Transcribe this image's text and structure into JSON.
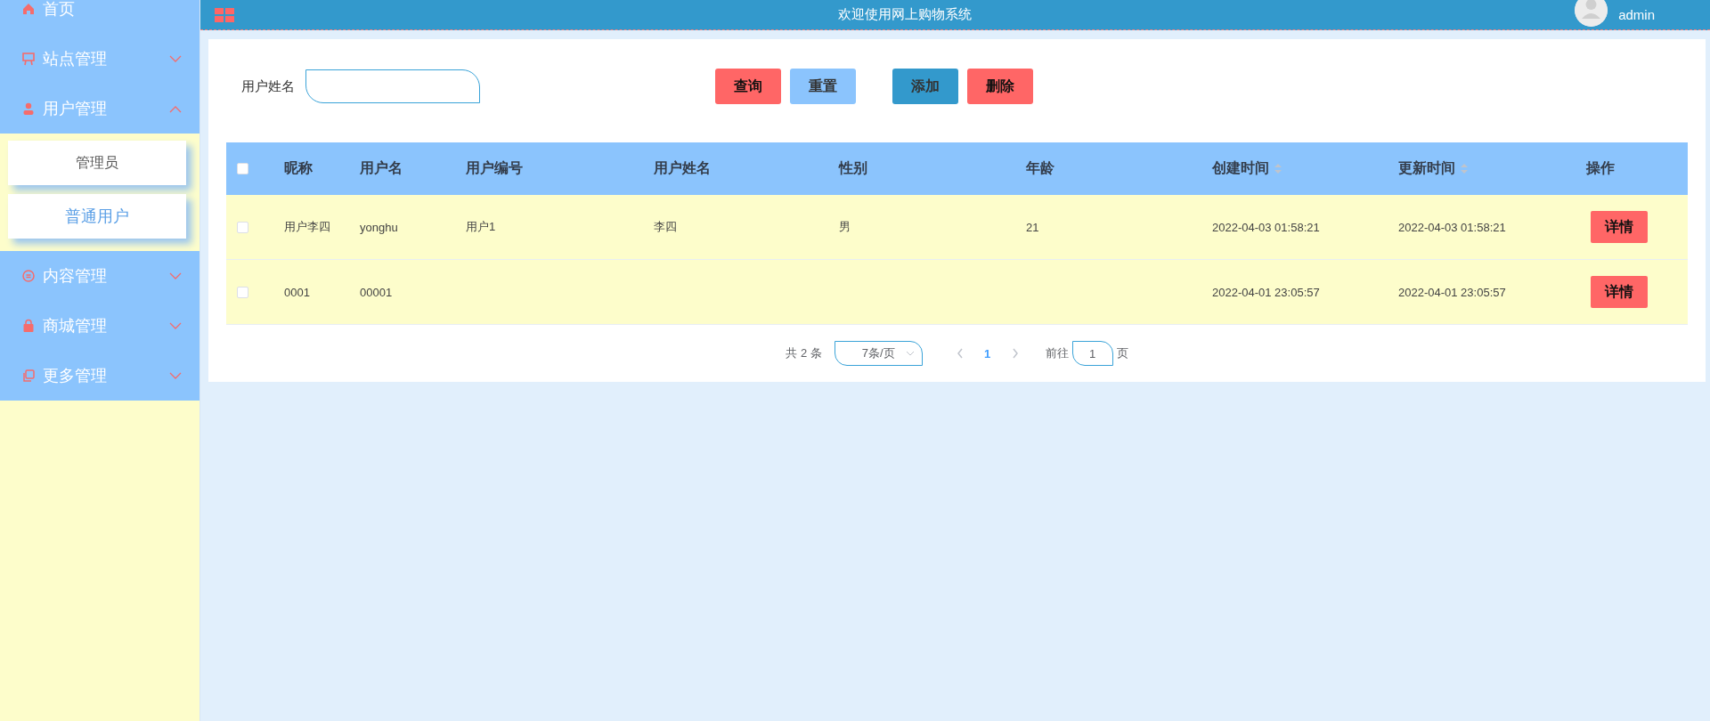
{
  "top_bar": {
    "title": "欢迎使用网上购物系统",
    "user": "admin"
  },
  "sidebar": {
    "items": [
      {
        "label": "首页",
        "kind": "link"
      },
      {
        "label": "站点管理",
        "kind": "submenu",
        "expanded": false
      },
      {
        "label": "用户管理",
        "kind": "submenu",
        "expanded": true,
        "children": [
          {
            "label": "管理员",
            "selected": false
          },
          {
            "label": "普通用户",
            "selected": true
          }
        ]
      },
      {
        "label": "内容管理",
        "kind": "submenu",
        "expanded": false
      },
      {
        "label": "商城管理",
        "kind": "submenu",
        "expanded": false
      },
      {
        "label": "更多管理",
        "kind": "submenu",
        "expanded": false
      }
    ]
  },
  "search": {
    "label": "用户姓名"
  },
  "buttons": [
    {
      "label": "查询",
      "kind": "danger"
    },
    {
      "label": "重置",
      "kind": "light"
    },
    {
      "label": "添加",
      "kind": "primary"
    },
    {
      "label": "删除",
      "kind": "danger"
    }
  ],
  "table": {
    "header_checked": false,
    "columns": [
      {
        "label": "昵称",
        "sortable": false
      },
      {
        "label": "用户名",
        "sortable": false
      },
      {
        "label": "用户编号",
        "sortable": false
      },
      {
        "label": "用户姓名",
        "sortable": false
      },
      {
        "label": "性别",
        "sortable": false
      },
      {
        "label": "年龄",
        "sortable": false
      },
      {
        "label": "创建时间",
        "sortable": true
      },
      {
        "label": "更新时间",
        "sortable": true
      },
      {
        "label": "操作",
        "sortable": false
      }
    ],
    "rows": [
      {
        "checked": false,
        "cells": [
          "用户李四",
          "yonghu",
          "用户1",
          "李四",
          "男",
          "21",
          "2022-04-03 01:58:21",
          "2022-04-03 01:58:21"
        ],
        "action": "详情"
      },
      {
        "checked": false,
        "cells": [
          "0001",
          "00001",
          "",
          "",
          "",
          "",
          "2022-04-01 23:05:57",
          "2022-04-01 23:05:57"
        ],
        "action": "详情"
      }
    ]
  },
  "pagination": {
    "total": "共 2 条",
    "page_size": "7条/页",
    "pages": [
      {
        "label": "1",
        "selected": true
      }
    ],
    "goto_label": "前往",
    "goto_value": "1",
    "goto_suffix": "页"
  }
}
